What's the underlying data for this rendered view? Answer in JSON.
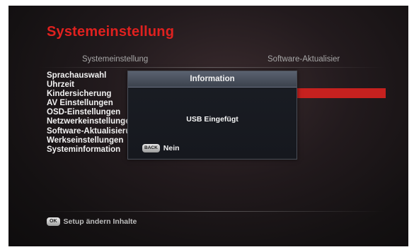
{
  "page": {
    "title": "Systemeinstellung"
  },
  "columns": {
    "left": "Systemeinstellung",
    "right": "Software-Aktualisier"
  },
  "menu": {
    "items": [
      "Sprachauswahl",
      "Uhrzeit",
      "Kindersicherung",
      "AV Einstellungen",
      "OSD-Einstellungen",
      "Netzwerkeinstellungen",
      "Software-Aktualisierung",
      "Werkseinstellungen",
      "Systeminformation"
    ]
  },
  "dialog": {
    "title": "Information",
    "message": "USB Eingefügt",
    "button_key": "BACK",
    "button_label": "Nein"
  },
  "footer": {
    "key": "OK",
    "text": "Setup ändern Inhalte"
  },
  "colors": {
    "accent": "#e0211f",
    "highlight": "#c6211f"
  }
}
